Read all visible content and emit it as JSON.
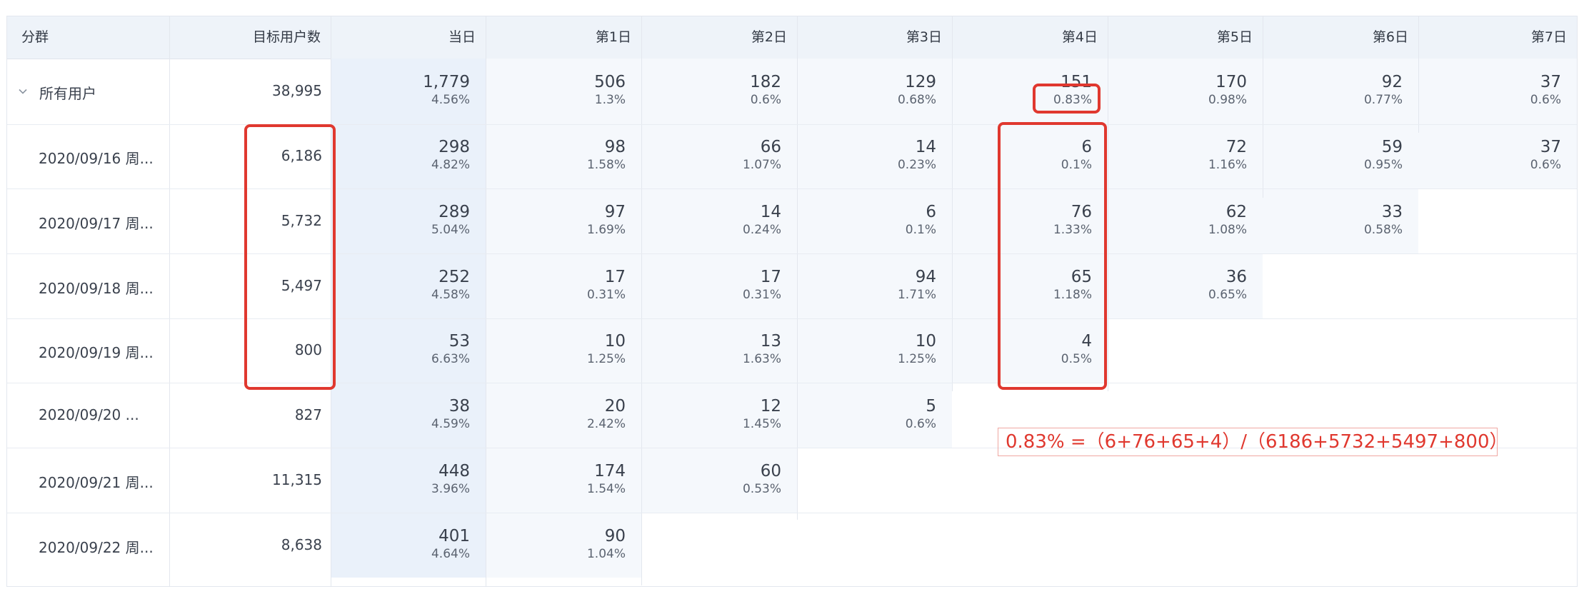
{
  "table": {
    "headers": {
      "segment": "分群",
      "target_users": "目标用户数",
      "days": [
        "当日",
        "第1日",
        "第2日",
        "第3日",
        "第4日",
        "第5日",
        "第6日",
        "第7日"
      ]
    },
    "rows": [
      {
        "segment": "所有用户",
        "target": "38,995",
        "cells": [
          {
            "count": "1,779",
            "pct": "4.56%"
          },
          {
            "count": "506",
            "pct": "1.3%"
          },
          {
            "count": "182",
            "pct": "0.6%"
          },
          {
            "count": "129",
            "pct": "0.68%"
          },
          {
            "count": "151",
            "pct": "0.83%"
          },
          {
            "count": "170",
            "pct": "0.98%"
          },
          {
            "count": "92",
            "pct": "0.77%"
          },
          {
            "count": "37",
            "pct": "0.6%"
          }
        ]
      },
      {
        "segment": "2020/09/16 周...",
        "target": "6,186",
        "cells": [
          {
            "count": "298",
            "pct": "4.82%"
          },
          {
            "count": "98",
            "pct": "1.58%"
          },
          {
            "count": "66",
            "pct": "1.07%"
          },
          {
            "count": "14",
            "pct": "0.23%"
          },
          {
            "count": "6",
            "pct": "0.1%"
          },
          {
            "count": "72",
            "pct": "1.16%"
          },
          {
            "count": "59",
            "pct": "0.95%"
          },
          {
            "count": "37",
            "pct": "0.6%"
          }
        ]
      },
      {
        "segment": "2020/09/17 周...",
        "target": "5,732",
        "cells": [
          {
            "count": "289",
            "pct": "5.04%"
          },
          {
            "count": "97",
            "pct": "1.69%"
          },
          {
            "count": "14",
            "pct": "0.24%"
          },
          {
            "count": "6",
            "pct": "0.1%"
          },
          {
            "count": "76",
            "pct": "1.33%"
          },
          {
            "count": "62",
            "pct": "1.08%"
          },
          {
            "count": "33",
            "pct": "0.58%"
          }
        ]
      },
      {
        "segment": "2020/09/18 周...",
        "target": "5,497",
        "cells": [
          {
            "count": "252",
            "pct": "4.58%"
          },
          {
            "count": "17",
            "pct": "0.31%"
          },
          {
            "count": "17",
            "pct": "0.31%"
          },
          {
            "count": "94",
            "pct": "1.71%"
          },
          {
            "count": "65",
            "pct": "1.18%"
          },
          {
            "count": "36",
            "pct": "0.65%"
          }
        ]
      },
      {
        "segment": "2020/09/19 周...",
        "target": "800",
        "cells": [
          {
            "count": "53",
            "pct": "6.63%"
          },
          {
            "count": "10",
            "pct": "1.25%"
          },
          {
            "count": "13",
            "pct": "1.63%"
          },
          {
            "count": "10",
            "pct": "1.25%"
          },
          {
            "count": "4",
            "pct": "0.5%"
          }
        ]
      },
      {
        "segment": "2020/09/20 ...",
        "target": "827",
        "cells": [
          {
            "count": "38",
            "pct": "4.59%"
          },
          {
            "count": "20",
            "pct": "2.42%"
          },
          {
            "count": "12",
            "pct": "1.45%"
          },
          {
            "count": "5",
            "pct": "0.6%"
          }
        ]
      },
      {
        "segment": "2020/09/21 周...",
        "target": "11,315",
        "cells": [
          {
            "count": "448",
            "pct": "3.96%"
          },
          {
            "count": "174",
            "pct": "1.54%"
          },
          {
            "count": "60",
            "pct": "0.53%"
          }
        ]
      },
      {
        "segment": "2020/09/22 周...",
        "target": "8,638",
        "cells": [
          {
            "count": "401",
            "pct": "4.64%"
          },
          {
            "count": "90",
            "pct": "1.04%"
          }
        ]
      }
    ]
  },
  "annotation": {
    "formula": "0.83% =（6+76+65+4）/（6186+5732+5497+800）"
  },
  "colors": {
    "header_bg": "#eef3f9",
    "border": "#e3e7ee",
    "heat_strong": "#eaf1fa",
    "heat_light": "#f5f8fc",
    "annotation_red": "#e0382f"
  }
}
